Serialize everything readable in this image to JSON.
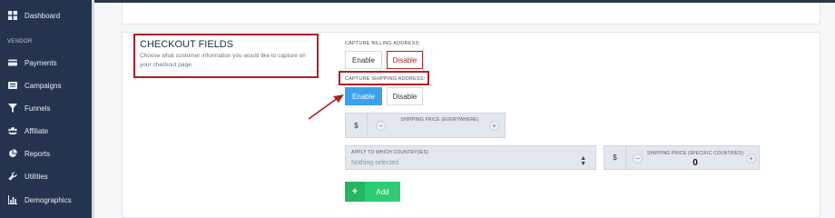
{
  "sidebar": {
    "items": [
      {
        "label": "Dashboard",
        "icon": "dashboard-icon"
      },
      {
        "label": "Payments",
        "icon": "credit-card-icon"
      },
      {
        "label": "Campaigns",
        "icon": "campaigns-icon"
      },
      {
        "label": "Funnels",
        "icon": "funnel-icon"
      },
      {
        "label": "Affiliate",
        "icon": "users-icon"
      },
      {
        "label": "Reports",
        "icon": "pie-chart-icon"
      },
      {
        "label": "Utilities",
        "icon": "wrench-icon"
      },
      {
        "label": "Demographics",
        "icon": "bar-chart-icon"
      }
    ],
    "section_label": "VENDOR"
  },
  "checkout_fields": {
    "title": "CHECKOUT FIELDS",
    "description": "Choose what customer information you would like to capture on your checkout page."
  },
  "billing": {
    "label": "CAPTURE BILLING ADDRESS:",
    "enable_label": "Enable",
    "disable_label": "Disable",
    "selected": "Disable"
  },
  "shipping": {
    "label": "CAPTURE SHIPPING ADDRESS:",
    "enable_label": "Enable",
    "disable_label": "Disable",
    "selected": "Enable"
  },
  "shipping_price_everywhere": {
    "currency": "$",
    "label": "SHIPPING PRICE (EVERYWHERE)",
    "minus": "−",
    "plus": "+"
  },
  "country_select": {
    "label": "APPLY TO WHICH COUNTRY(IES)",
    "placeholder": "Nothing selected"
  },
  "shipping_price_specific": {
    "currency": "$",
    "label": "SHIPPING PRICE (SPECIFIC COUNTRIES)",
    "value": "0",
    "minus": "−",
    "plus": "+"
  },
  "add_button": {
    "plus": "+",
    "label": "Add"
  },
  "colors": {
    "sidebar_bg": "#25344e",
    "highlight": "#b01f24",
    "enable_active": "#3aa2ea",
    "add_green": "#2ecc71"
  }
}
